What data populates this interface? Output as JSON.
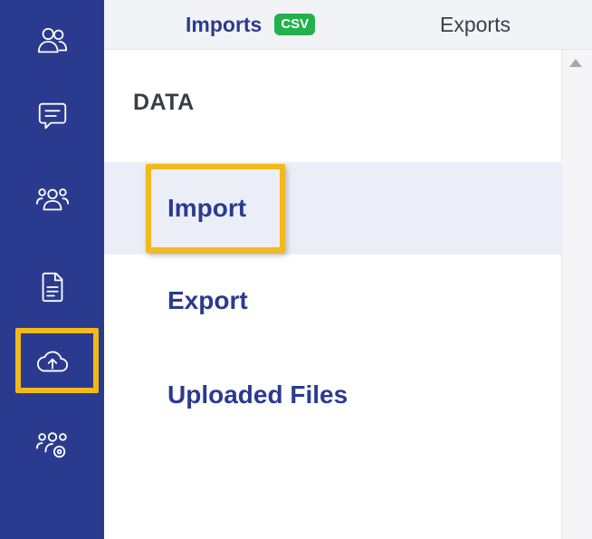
{
  "rail": {
    "items": [
      {
        "icon": "contacts-icon",
        "active": false
      },
      {
        "icon": "message-icon",
        "active": false
      },
      {
        "icon": "group-icon",
        "active": false
      },
      {
        "icon": "document-icon",
        "active": false
      },
      {
        "icon": "cloud-upload-icon",
        "active": true
      },
      {
        "icon": "team-settings-icon",
        "active": false
      }
    ],
    "highlight_color": "#f2b91b",
    "background_color": "#2a3b8f"
  },
  "tabs": {
    "imports": {
      "label": "Imports",
      "badge": "CSV"
    },
    "exports": {
      "label": "Exports"
    }
  },
  "panel": {
    "section_title": "DATA",
    "items": [
      {
        "label": "Import",
        "active": true
      },
      {
        "label": "Export",
        "active": false
      },
      {
        "label": "Uploaded Files",
        "active": false
      }
    ]
  },
  "colors": {
    "accent": "#2a3b8f",
    "badge": "#22b14c",
    "highlight": "#f2b91b",
    "active_row": "#eceef7"
  }
}
